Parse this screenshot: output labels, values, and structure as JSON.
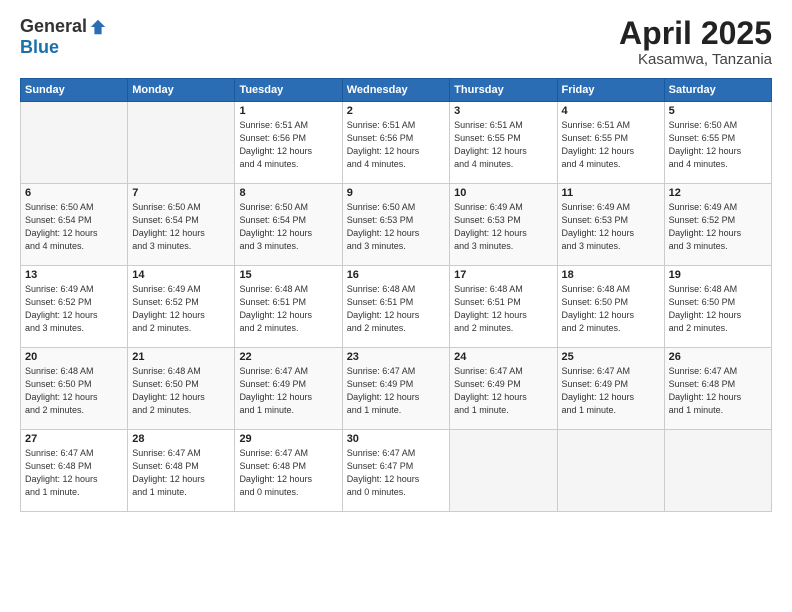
{
  "logo": {
    "general": "General",
    "blue": "Blue"
  },
  "header": {
    "month": "April 2025",
    "location": "Kasamwa, Tanzania"
  },
  "weekdays": [
    "Sunday",
    "Monday",
    "Tuesday",
    "Wednesday",
    "Thursday",
    "Friday",
    "Saturday"
  ],
  "weeks": [
    [
      {
        "day": "",
        "info": ""
      },
      {
        "day": "",
        "info": ""
      },
      {
        "day": "1",
        "info": "Sunrise: 6:51 AM\nSunset: 6:56 PM\nDaylight: 12 hours\nand 4 minutes."
      },
      {
        "day": "2",
        "info": "Sunrise: 6:51 AM\nSunset: 6:56 PM\nDaylight: 12 hours\nand 4 minutes."
      },
      {
        "day": "3",
        "info": "Sunrise: 6:51 AM\nSunset: 6:55 PM\nDaylight: 12 hours\nand 4 minutes."
      },
      {
        "day": "4",
        "info": "Sunrise: 6:51 AM\nSunset: 6:55 PM\nDaylight: 12 hours\nand 4 minutes."
      },
      {
        "day": "5",
        "info": "Sunrise: 6:50 AM\nSunset: 6:55 PM\nDaylight: 12 hours\nand 4 minutes."
      }
    ],
    [
      {
        "day": "6",
        "info": "Sunrise: 6:50 AM\nSunset: 6:54 PM\nDaylight: 12 hours\nand 4 minutes."
      },
      {
        "day": "7",
        "info": "Sunrise: 6:50 AM\nSunset: 6:54 PM\nDaylight: 12 hours\nand 3 minutes."
      },
      {
        "day": "8",
        "info": "Sunrise: 6:50 AM\nSunset: 6:54 PM\nDaylight: 12 hours\nand 3 minutes."
      },
      {
        "day": "9",
        "info": "Sunrise: 6:50 AM\nSunset: 6:53 PM\nDaylight: 12 hours\nand 3 minutes."
      },
      {
        "day": "10",
        "info": "Sunrise: 6:49 AM\nSunset: 6:53 PM\nDaylight: 12 hours\nand 3 minutes."
      },
      {
        "day": "11",
        "info": "Sunrise: 6:49 AM\nSunset: 6:53 PM\nDaylight: 12 hours\nand 3 minutes."
      },
      {
        "day": "12",
        "info": "Sunrise: 6:49 AM\nSunset: 6:52 PM\nDaylight: 12 hours\nand 3 minutes."
      }
    ],
    [
      {
        "day": "13",
        "info": "Sunrise: 6:49 AM\nSunset: 6:52 PM\nDaylight: 12 hours\nand 3 minutes."
      },
      {
        "day": "14",
        "info": "Sunrise: 6:49 AM\nSunset: 6:52 PM\nDaylight: 12 hours\nand 2 minutes."
      },
      {
        "day": "15",
        "info": "Sunrise: 6:48 AM\nSunset: 6:51 PM\nDaylight: 12 hours\nand 2 minutes."
      },
      {
        "day": "16",
        "info": "Sunrise: 6:48 AM\nSunset: 6:51 PM\nDaylight: 12 hours\nand 2 minutes."
      },
      {
        "day": "17",
        "info": "Sunrise: 6:48 AM\nSunset: 6:51 PM\nDaylight: 12 hours\nand 2 minutes."
      },
      {
        "day": "18",
        "info": "Sunrise: 6:48 AM\nSunset: 6:50 PM\nDaylight: 12 hours\nand 2 minutes."
      },
      {
        "day": "19",
        "info": "Sunrise: 6:48 AM\nSunset: 6:50 PM\nDaylight: 12 hours\nand 2 minutes."
      }
    ],
    [
      {
        "day": "20",
        "info": "Sunrise: 6:48 AM\nSunset: 6:50 PM\nDaylight: 12 hours\nand 2 minutes."
      },
      {
        "day": "21",
        "info": "Sunrise: 6:48 AM\nSunset: 6:50 PM\nDaylight: 12 hours\nand 2 minutes."
      },
      {
        "day": "22",
        "info": "Sunrise: 6:47 AM\nSunset: 6:49 PM\nDaylight: 12 hours\nand 1 minute."
      },
      {
        "day": "23",
        "info": "Sunrise: 6:47 AM\nSunset: 6:49 PM\nDaylight: 12 hours\nand 1 minute."
      },
      {
        "day": "24",
        "info": "Sunrise: 6:47 AM\nSunset: 6:49 PM\nDaylight: 12 hours\nand 1 minute."
      },
      {
        "day": "25",
        "info": "Sunrise: 6:47 AM\nSunset: 6:49 PM\nDaylight: 12 hours\nand 1 minute."
      },
      {
        "day": "26",
        "info": "Sunrise: 6:47 AM\nSunset: 6:48 PM\nDaylight: 12 hours\nand 1 minute."
      }
    ],
    [
      {
        "day": "27",
        "info": "Sunrise: 6:47 AM\nSunset: 6:48 PM\nDaylight: 12 hours\nand 1 minute."
      },
      {
        "day": "28",
        "info": "Sunrise: 6:47 AM\nSunset: 6:48 PM\nDaylight: 12 hours\nand 1 minute."
      },
      {
        "day": "29",
        "info": "Sunrise: 6:47 AM\nSunset: 6:48 PM\nDaylight: 12 hours\nand 0 minutes."
      },
      {
        "day": "30",
        "info": "Sunrise: 6:47 AM\nSunset: 6:47 PM\nDaylight: 12 hours\nand 0 minutes."
      },
      {
        "day": "",
        "info": ""
      },
      {
        "day": "",
        "info": ""
      },
      {
        "day": "",
        "info": ""
      }
    ]
  ]
}
